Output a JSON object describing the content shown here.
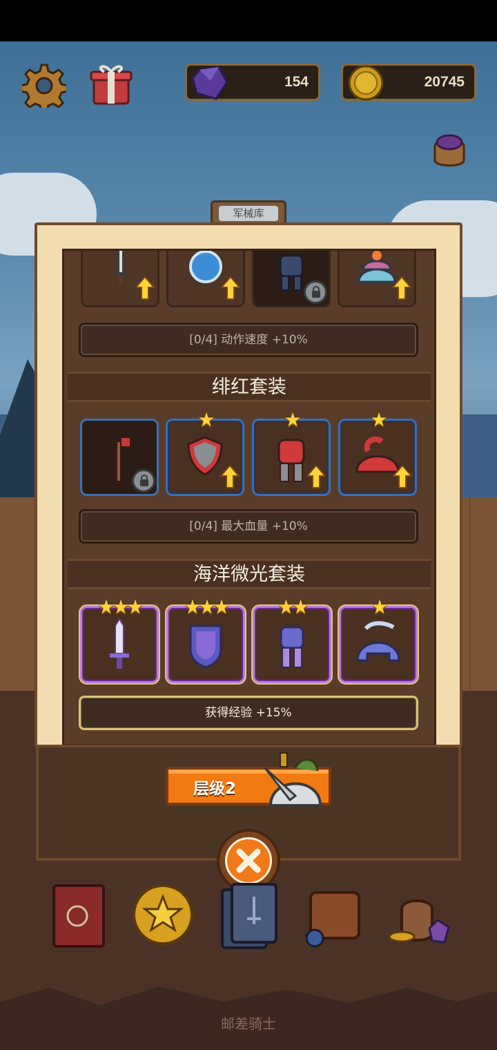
{
  "hud": {
    "gems": "154",
    "coins": "20745",
    "icons": [
      "gear-icon",
      "gift-icon",
      "gem-icon",
      "coin-icon",
      "bag-icon"
    ]
  },
  "panel": {
    "tab_label": "军械库",
    "sets": [
      {
        "title": "",
        "bonus": "[0/4] 动作速度 +10%",
        "slots": [
          {
            "icon": "dagger-icon",
            "stars": "",
            "upgrade": true,
            "locked": false
          },
          {
            "icon": "orb-icon",
            "stars": "",
            "upgrade": true,
            "locked": false
          },
          {
            "icon": "armor-icon",
            "stars": "",
            "upgrade": false,
            "locked": true
          },
          {
            "icon": "hat-icon",
            "stars": "",
            "upgrade": true,
            "locked": false
          }
        ]
      },
      {
        "title": "绯红套装",
        "bonus": "[0/4] 最大血量 +10%",
        "slots": [
          {
            "icon": "axe-icon",
            "stars": "",
            "upgrade": false,
            "locked": true
          },
          {
            "icon": "shield-icon",
            "stars": "★",
            "upgrade": true,
            "locked": false
          },
          {
            "icon": "armor-icon",
            "stars": "★",
            "upgrade": true,
            "locked": false
          },
          {
            "icon": "helmet-icon",
            "stars": "★",
            "upgrade": true,
            "locked": false
          }
        ]
      },
      {
        "title": "海洋微光套装",
        "bonus": "获得经验 +15%",
        "slots": [
          {
            "icon": "sword-icon",
            "stars": "★★★",
            "upgrade": false,
            "locked": false
          },
          {
            "icon": "shield-icon",
            "stars": "★★★",
            "upgrade": false,
            "locked": false
          },
          {
            "icon": "armor-icon",
            "stars": "★★",
            "upgrade": false,
            "locked": false
          },
          {
            "icon": "helmet-icon",
            "stars": "★",
            "upgrade": false,
            "locked": false
          }
        ]
      }
    ]
  },
  "level_button": {
    "label": "层级2"
  },
  "dock": [
    "book-icon",
    "star-coin-icon",
    "card-icon",
    "backpack-icon",
    "treasure-icon"
  ],
  "footer": {
    "title": "邮差骑士"
  },
  "colors": {
    "accent": "#f27a12",
    "blue_rarity": "#3d6fb6",
    "purple_rarity": "#b87ed6",
    "star": "#ffd23a"
  }
}
